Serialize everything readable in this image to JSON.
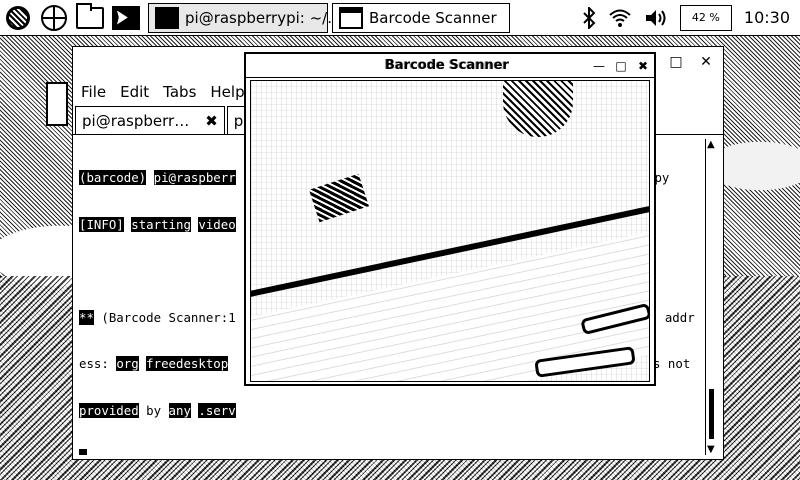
{
  "taskbar": {
    "terminal_task": "pi@raspberrypi: ~/...",
    "scanner_task": "Barcode Scanner",
    "cpu": "42 %",
    "clock": "10:30"
  },
  "terminal": {
    "menu": [
      "File",
      "Edit",
      "Tabs",
      "Help"
    ],
    "tabs": [
      {
        "label": "pi@raspberr…"
      },
      {
        "label": "pi@"
      }
    ],
    "lines": [
      {
        "a": "(barcode)",
        "b": " ",
        "c": "pi@raspberr",
        "d": "",
        "e": "",
        "tail": ":py"
      },
      {
        "a": "[INFO]",
        "b": " ",
        "c": "starting",
        "d": " ",
        "e": "video",
        "tail": ""
      },
      {
        "a": "",
        "b": "",
        "c": "",
        "d": "",
        "e": "",
        "tail": ""
      },
      {
        "a": "**",
        "b": " (Barcode ",
        "c": "Scanner:1",
        "d": "",
        "e": "",
        "tail": "bus addr"
      },
      {
        "a": "ess:",
        "b": " ",
        "c": "org",
        "d": " ",
        "e": "freedesktop",
        "tail": "s not"
      },
      {
        "a": "provided",
        "b": " by ",
        "c": "any",
        "d": " ",
        "e": ".serv",
        "tail": ""
      }
    ]
  },
  "scanner": {
    "title": "Barcode Scanner"
  },
  "colors": {
    "foreground": "#000000",
    "background": "#ffffff"
  }
}
